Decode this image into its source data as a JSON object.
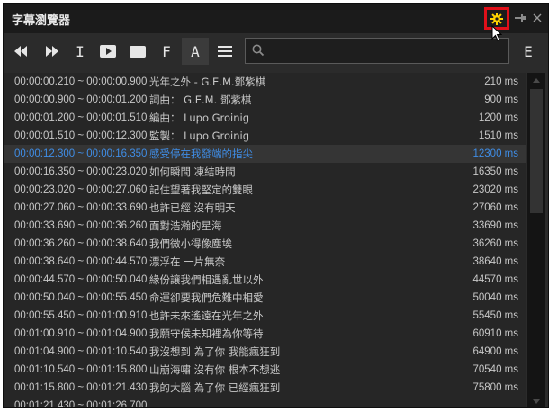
{
  "window": {
    "title": "字幕瀏覽器"
  },
  "search": {
    "value": "",
    "placeholder": ""
  },
  "toolbar": {
    "tool_i": "I",
    "tool_f": "F",
    "tool_a": "A",
    "tool_e": "E"
  },
  "colors": {
    "selected_text": "#3f8de6",
    "highlight_border": "#e0101a",
    "gear": "#ffd400"
  },
  "icons": [
    "rewind-icon",
    "fast-forward-icon",
    "text-cursor-icon",
    "play-icon",
    "rectangle-icon",
    "menu-icon",
    "search-icon",
    "gear-icon",
    "pin-icon",
    "close-icon"
  ],
  "list": {
    "rows": [
      {
        "time": "00:00:00.210 ~ 00:00:00.900",
        "text": "光年之外 - G.E.M.鄧紫棋",
        "dur": "210 ms"
      },
      {
        "time": "00:00:00.900 ~ 00:00:01.200",
        "text": "詞曲： G.E.M. 鄧紫棋",
        "dur": "900 ms"
      },
      {
        "time": "00:00:01.200 ~ 00:00:01.510",
        "text": "編曲： Lupo Groinig",
        "dur": "1200 ms"
      },
      {
        "time": "00:00:01.510 ~ 00:00:12.300",
        "text": "監製： Lupo Groinig",
        "dur": "1510 ms"
      },
      {
        "time": "00:00:12.300 ~ 00:00:16.350",
        "text": "感受停在我發端的指尖",
        "dur": "12300 ms"
      },
      {
        "time": "00:00:16.350 ~ 00:00:23.020",
        "text": "如何瞬間 凍結時間",
        "dur": "16350 ms"
      },
      {
        "time": "00:00:23.020 ~ 00:00:27.060",
        "text": "記住望著我堅定的雙眼",
        "dur": "23020 ms"
      },
      {
        "time": "00:00:27.060 ~ 00:00:33.690",
        "text": "也許已經 沒有明天",
        "dur": "27060 ms"
      },
      {
        "time": "00:00:33.690 ~ 00:00:36.260",
        "text": "面對浩瀚的星海",
        "dur": "33690 ms"
      },
      {
        "time": "00:00:36.260 ~ 00:00:38.640",
        "text": "我們微小得像塵埃",
        "dur": "36260 ms"
      },
      {
        "time": "00:00:38.640 ~ 00:00:44.570",
        "text": "漂浮在 一片無奈",
        "dur": "38640 ms"
      },
      {
        "time": "00:00:44.570 ~ 00:00:50.040",
        "text": "緣份讓我們相遇亂世以外",
        "dur": "44570 ms"
      },
      {
        "time": "00:00:50.040 ~ 00:00:55.450",
        "text": "命運卻要我們危難中相愛",
        "dur": "50040 ms"
      },
      {
        "time": "00:00:55.450 ~ 00:01:00.910",
        "text": "也許未來遙遠在光年之外",
        "dur": "55450 ms"
      },
      {
        "time": "00:01:00.910 ~ 00:01:04.900",
        "text": "我願守候未知裡為你等待",
        "dur": "60910 ms"
      },
      {
        "time": "00:01:04.900 ~ 00:01:10.540",
        "text": "我沒想到 為了你 我能瘋狂到",
        "dur": "64900 ms"
      },
      {
        "time": "00:01:10.540 ~ 00:01:15.800",
        "text": "山崩海嘯 沒有你 根本不想逃",
        "dur": "70540 ms"
      },
      {
        "time": "00:01:15.800 ~ 00:01:21.430",
        "text": "我的大腦 為了你 已經瘋狂到",
        "dur": "75800 ms"
      },
      {
        "time": "00:01:21.430 ~ 00:01:26.700",
        "text": "",
        "dur": ""
      }
    ],
    "selected_index": 4
  }
}
